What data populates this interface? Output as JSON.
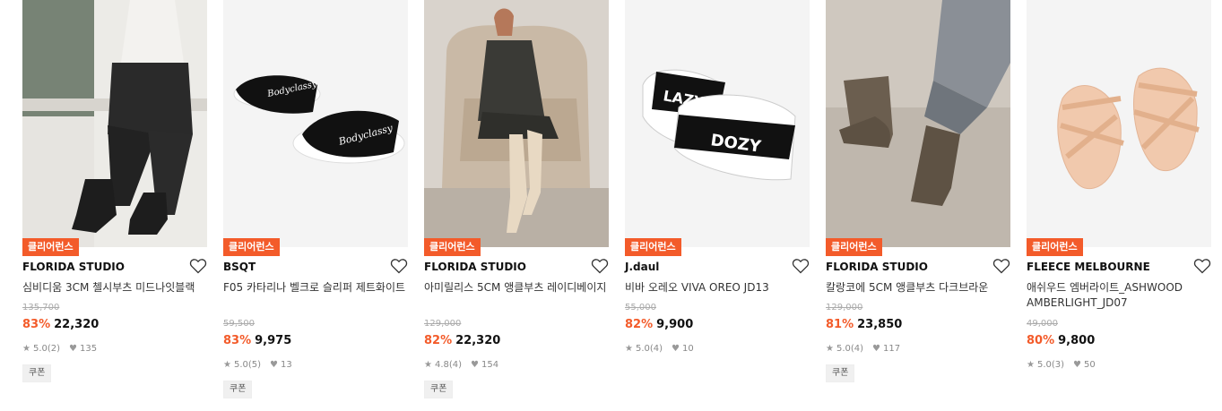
{
  "products": [
    {
      "badge": "클리어런스",
      "brand": "FLORIDA STUDIO",
      "name": "심비디움 3CM 첼시부츠 미드나잇블랙",
      "original_price": "135,700",
      "discount": "83%",
      "price": "22,320",
      "rating": "5.0",
      "reviews": "(2)",
      "likes": "135",
      "coupon": "쿠폰"
    },
    {
      "badge": "클리어런스",
      "brand": "BSQT",
      "name": "F05 카타리나 벨크로 슬리퍼 제트화이트",
      "original_price": "59,500",
      "discount": "83%",
      "price": "9,975",
      "rating": "5.0",
      "reviews": "(5)",
      "likes": "13",
      "coupon": "쿠폰"
    },
    {
      "badge": "클리어런스",
      "brand": "FLORIDA STUDIO",
      "name": "아미릴리스 5CM 앵클부츠 레이디베이지",
      "original_price": "129,000",
      "discount": "82%",
      "price": "22,320",
      "rating": "4.8",
      "reviews": "(4)",
      "likes": "154",
      "coupon": "쿠폰"
    },
    {
      "badge": "클리어런스",
      "brand": "J.daul",
      "name": "비바 오레오 VIVA OREO JD13",
      "original_price": "55,000",
      "discount": "82%",
      "price": "9,900",
      "rating": "5.0",
      "reviews": "(4)",
      "likes": "10",
      "coupon": ""
    },
    {
      "badge": "클리어런스",
      "brand": "FLORIDA STUDIO",
      "name": "칼랑코에 5CM 앵클부츠 다크브라운",
      "original_price": "129,000",
      "discount": "81%",
      "price": "23,850",
      "rating": "5.0",
      "reviews": "(4)",
      "likes": "117",
      "coupon": "쿠폰"
    },
    {
      "badge": "클리어런스",
      "brand": "FLEECE MELBOURNE",
      "name": "애쉬우드 엠버라이트_ASHWOOD AMBERLIGHT_JD07",
      "original_price": "49,000",
      "discount": "80%",
      "price": "9,800",
      "rating": "5.0",
      "reviews": "(3)",
      "likes": "50",
      "coupon": ""
    }
  ],
  "image_text": {
    "p2_strap": "Bodyclassy",
    "p4_strap_a": "LAZY",
    "p4_strap_b": "DOZY"
  },
  "colors": {
    "accent": "#f35b2a",
    "text": "#222222",
    "muted": "#888888"
  },
  "icons": {
    "wishlist": "heart-outline-icon",
    "rating": "star-icon",
    "likes": "heart-filled-icon"
  }
}
